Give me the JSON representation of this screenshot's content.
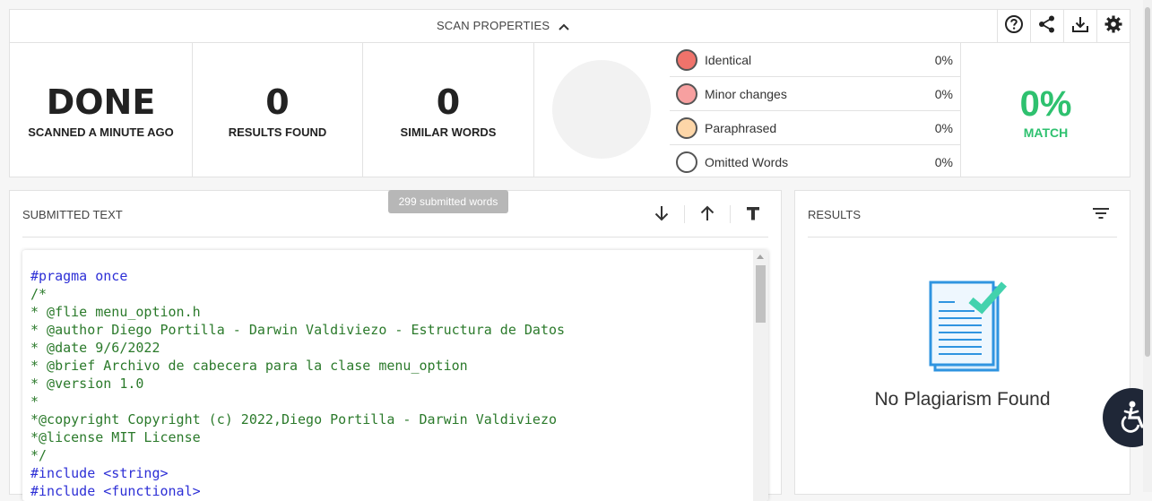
{
  "scan_properties": {
    "title": "SCAN PROPERTIES",
    "tools": [
      "help-icon",
      "share-icon",
      "download-icon",
      "settings-icon"
    ]
  },
  "stats": {
    "status": {
      "value": "DONE",
      "label": "SCANNED A MINUTE AGO"
    },
    "results": {
      "value": "0",
      "label": "RESULTS FOUND"
    },
    "similar": {
      "value": "0",
      "label": "SIMILAR WORDS"
    }
  },
  "legend": [
    {
      "name": "Identical",
      "pct": "0%",
      "color": "#f0736b"
    },
    {
      "name": "Minor changes",
      "pct": "0%",
      "color": "#f7a0a0"
    },
    {
      "name": "Paraphrased",
      "pct": "0%",
      "color": "#fdd6a8"
    },
    {
      "name": "Omitted Words",
      "pct": "0%",
      "color": "#ffffff"
    }
  ],
  "match": {
    "value": "0%",
    "label": "MATCH",
    "color": "#2ec16f"
  },
  "submitted": {
    "title": "SUBMITTED TEXT",
    "tooltip": "299 submitted words",
    "code_lines": [
      {
        "text": "#pragma once",
        "kind": "kw"
      },
      {
        "text": "/*",
        "kind": "cm"
      },
      {
        "text": "* @flie menu_option.h",
        "kind": "cm"
      },
      {
        "text": "* @author Diego Portilla - Darwin Valdiviezo - Estructura de Datos",
        "kind": "cm"
      },
      {
        "text": "* @date 9/6/2022",
        "kind": "cm"
      },
      {
        "text": "* @brief Archivo de cabecera para la clase menu_option",
        "kind": "cm"
      },
      {
        "text": "* @version 1.0",
        "kind": "cm"
      },
      {
        "text": "*",
        "kind": "cm"
      },
      {
        "text": "*@copyright Copyright (c) 2022,Diego Portilla - Darwin Valdiviezo",
        "kind": "cm"
      },
      {
        "text": "*@license MIT License",
        "kind": "cm"
      },
      {
        "text": "*/",
        "kind": "cm"
      },
      {
        "text": "#include <string>",
        "kind": "kw"
      },
      {
        "text": "#include <functional>",
        "kind": "kw"
      }
    ]
  },
  "results": {
    "title": "RESULTS",
    "empty_message": "No Plagiarism Found"
  }
}
